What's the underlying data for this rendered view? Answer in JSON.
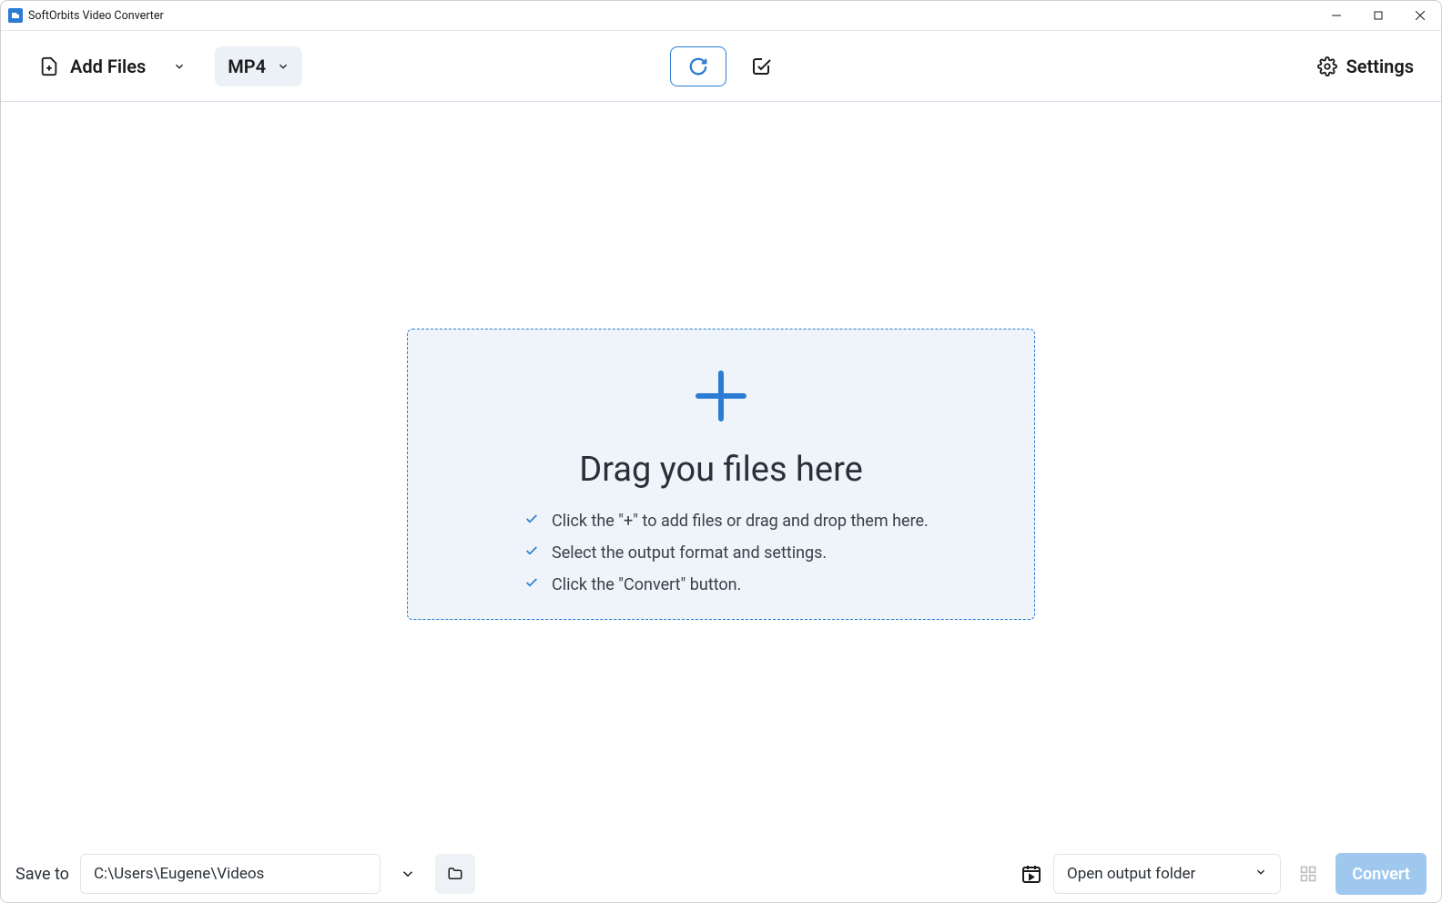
{
  "titlebar": {
    "title": "SoftOrbits Video Converter"
  },
  "toolbar": {
    "add_files": "Add Files",
    "format": "MP4",
    "settings": "Settings"
  },
  "dropzone": {
    "title": "Drag you files here",
    "step1": "Click the \"+\" to add files or drag and drop them here.",
    "step2": "Select the output format and settings.",
    "step3": "Click the \"Convert\" button."
  },
  "bottom": {
    "save_to": "Save to",
    "path": "C:\\Users\\Eugene\\Videos",
    "open_output": "Open output folder",
    "convert": "Convert"
  }
}
